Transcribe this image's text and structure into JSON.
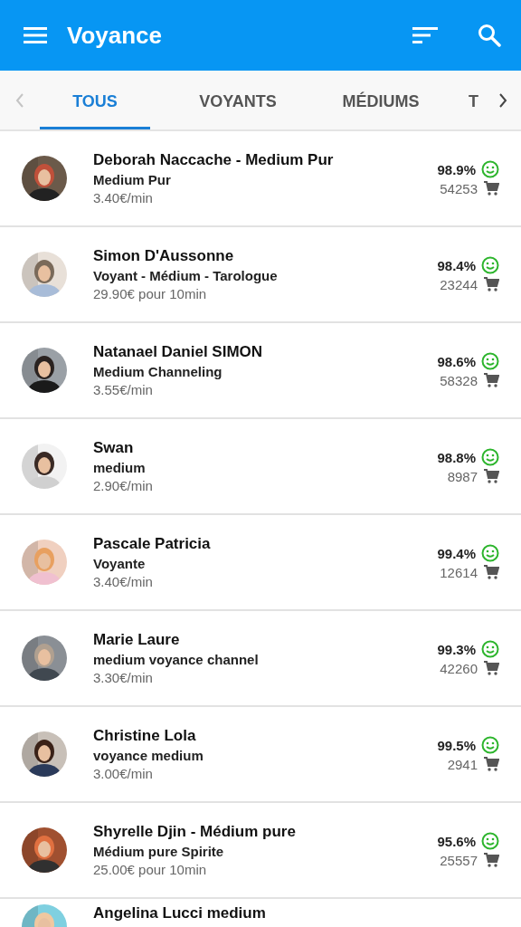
{
  "app_bar": {
    "title": "Voyance"
  },
  "tabs": [
    {
      "label": "TOUS",
      "selected": true
    },
    {
      "label": "VOYANTS",
      "selected": false
    },
    {
      "label": "MÉDIUMS",
      "selected": false
    },
    {
      "label": "T",
      "selected": false
    }
  ],
  "experts": [
    {
      "name": "Deborah Naccache - Medium Pur",
      "specialty": "Medium Pur",
      "price": "3.40€/min",
      "rating": "98.9%",
      "consultations": "54253"
    },
    {
      "name": "Simon D'Aussonne",
      "specialty": "Voyant - Médium - Tarologue",
      "price": "29.90€ pour 10min",
      "rating": "98.4%",
      "consultations": "23244"
    },
    {
      "name": "Natanael Daniel SIMON",
      "specialty": "Medium Channeling",
      "price": "3.55€/min",
      "rating": "98.6%",
      "consultations": "58328"
    },
    {
      "name": "Swan",
      "specialty": "medium",
      "price": "2.90€/min",
      "rating": "98.8%",
      "consultations": "8987"
    },
    {
      "name": "Pascale Patricia",
      "specialty": "Voyante",
      "price": "3.40€/min",
      "rating": "99.4%",
      "consultations": "12614"
    },
    {
      "name": "Marie Laure",
      "specialty": "medium voyance channel",
      "price": "3.30€/min",
      "rating": "99.3%",
      "consultations": "42260"
    },
    {
      "name": "Christine Lola",
      "specialty": "voyance medium",
      "price": "3.00€/min",
      "rating": "99.5%",
      "consultations": "2941"
    },
    {
      "name": "Shyrelle Djin - Médium pure",
      "specialty": "Médium pure Spirite",
      "price": "25.00€ pour 10min",
      "rating": "95.6%",
      "consultations": "25557"
    },
    {
      "name": "Angelina Lucci medium"
    }
  ]
}
